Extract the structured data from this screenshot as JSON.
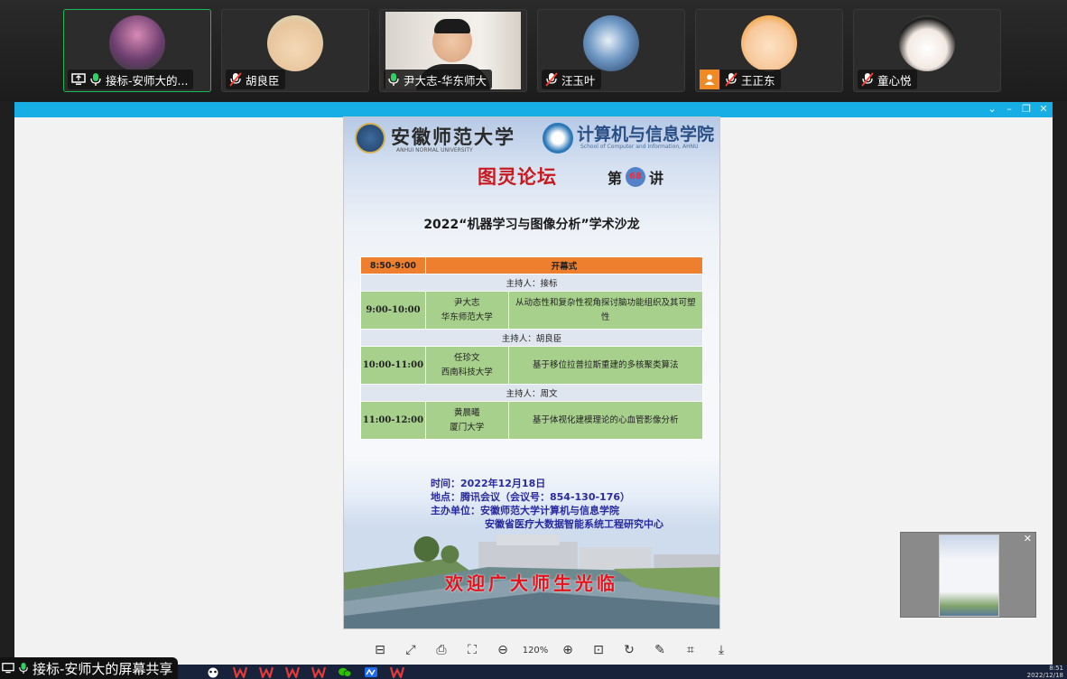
{
  "participants": [
    {
      "name": "接标-安师大的...",
      "mic": "on",
      "sharing": true,
      "active": true
    },
    {
      "name": "胡良臣",
      "mic": "muted",
      "sharing": false,
      "active": false
    },
    {
      "name": "尹大志-华东师大",
      "mic": "on",
      "sharing": false,
      "active": false
    },
    {
      "name": "汪玉叶",
      "mic": "muted",
      "sharing": false,
      "active": false
    },
    {
      "name": "王正东",
      "mic": "muted",
      "sharing": false,
      "active": false
    },
    {
      "name": "童心悦",
      "mic": "muted",
      "sharing": false,
      "active": false
    }
  ],
  "poster": {
    "university": "安徽师范大学",
    "university_en": "ANHUI NORMAL UNIVERSITY",
    "college": "计算机与信息学院",
    "college_en": "School of Computer and Information, AHNU",
    "forum": "图灵论坛",
    "lecture_prefix": "第",
    "lecture_number": "68",
    "lecture_suffix": "讲",
    "salon_title": "2022“机器学习与图像分析”学术沙龙",
    "schedule": {
      "opening_time": "8:50-9:00",
      "opening_label": "开幕式",
      "host1": "主持人：接标",
      "talk1_time": "9:00-10:00",
      "talk1_speaker": "尹大志",
      "talk1_affil": "华东师范大学",
      "talk1_title": "从动态性和复杂性视角探讨脑功能组织及其可塑性",
      "host2": "主持人：胡良臣",
      "talk2_time": "10:00-11:00",
      "talk2_speaker": "任珍文",
      "talk2_affil": "西南科技大学",
      "talk2_title": "基于移位拉普拉斯重建的多核聚类算法",
      "host3": "主持人：周文",
      "talk3_time": "11:00-12:00",
      "talk3_speaker": "黄晨曦",
      "talk3_affil": "厦门大学",
      "talk3_title": "基于体视化建模理论的心血管影像分析"
    },
    "time_line": "时间：2022年12月18日",
    "place_line": "地点：腾讯会议（会议号：854-130-176）",
    "organizer_line": "主办单位：安徽师范大学计算机与信息学院",
    "organizer_line2": "安徽省医疗大数据智能系统工程研究中心",
    "welcome": "欢迎广大师生光临"
  },
  "viewer": {
    "zoom": "120%"
  },
  "share_bar": {
    "label": "接标-安师大的屏幕共享"
  },
  "clock": {
    "time": "8:51",
    "date": "2022/12/18"
  },
  "colors": {
    "accent": "#17aee6",
    "active_border": "#1db954",
    "opening_row": "#ee7f2e",
    "talk_row": "#a8d08d",
    "host_row": "#dfe6f0",
    "welcome_red": "#e3121b"
  }
}
